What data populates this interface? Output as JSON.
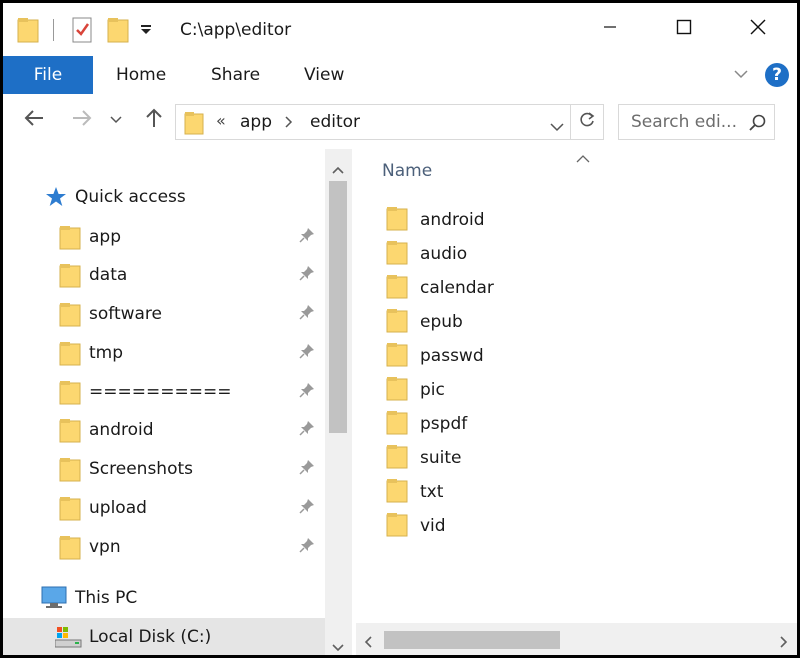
{
  "window": {
    "title": "C:\\app\\editor",
    "minimize_icon": "minimize-icon",
    "maximize_icon": "maximize-icon",
    "close_icon": "close-icon"
  },
  "ribbon": {
    "tabs": [
      {
        "label": "File"
      },
      {
        "label": "Home"
      },
      {
        "label": "Share"
      },
      {
        "label": "View"
      }
    ]
  },
  "address": {
    "overflow": "«",
    "crumbs": [
      "app",
      "editor"
    ],
    "search_placeholder": "Search edi..."
  },
  "navpane": {
    "quick_access": "Quick access",
    "pinned": [
      "app",
      "data",
      "software",
      "tmp",
      "==========",
      "android",
      "Screenshots",
      "upload",
      "vpn"
    ],
    "this_pc": "This PC",
    "local_disk": "Local Disk (C:)"
  },
  "content": {
    "column_name": "Name",
    "folders": [
      "android",
      "audio",
      "calendar",
      "epub",
      "passwd",
      "pic",
      "pspdf",
      "suite",
      "txt",
      "vid"
    ]
  },
  "colors": {
    "accent": "#1e6fc6",
    "folder": "#fcd770",
    "header_text": "#4c607a",
    "help": "#1e6fc6"
  }
}
